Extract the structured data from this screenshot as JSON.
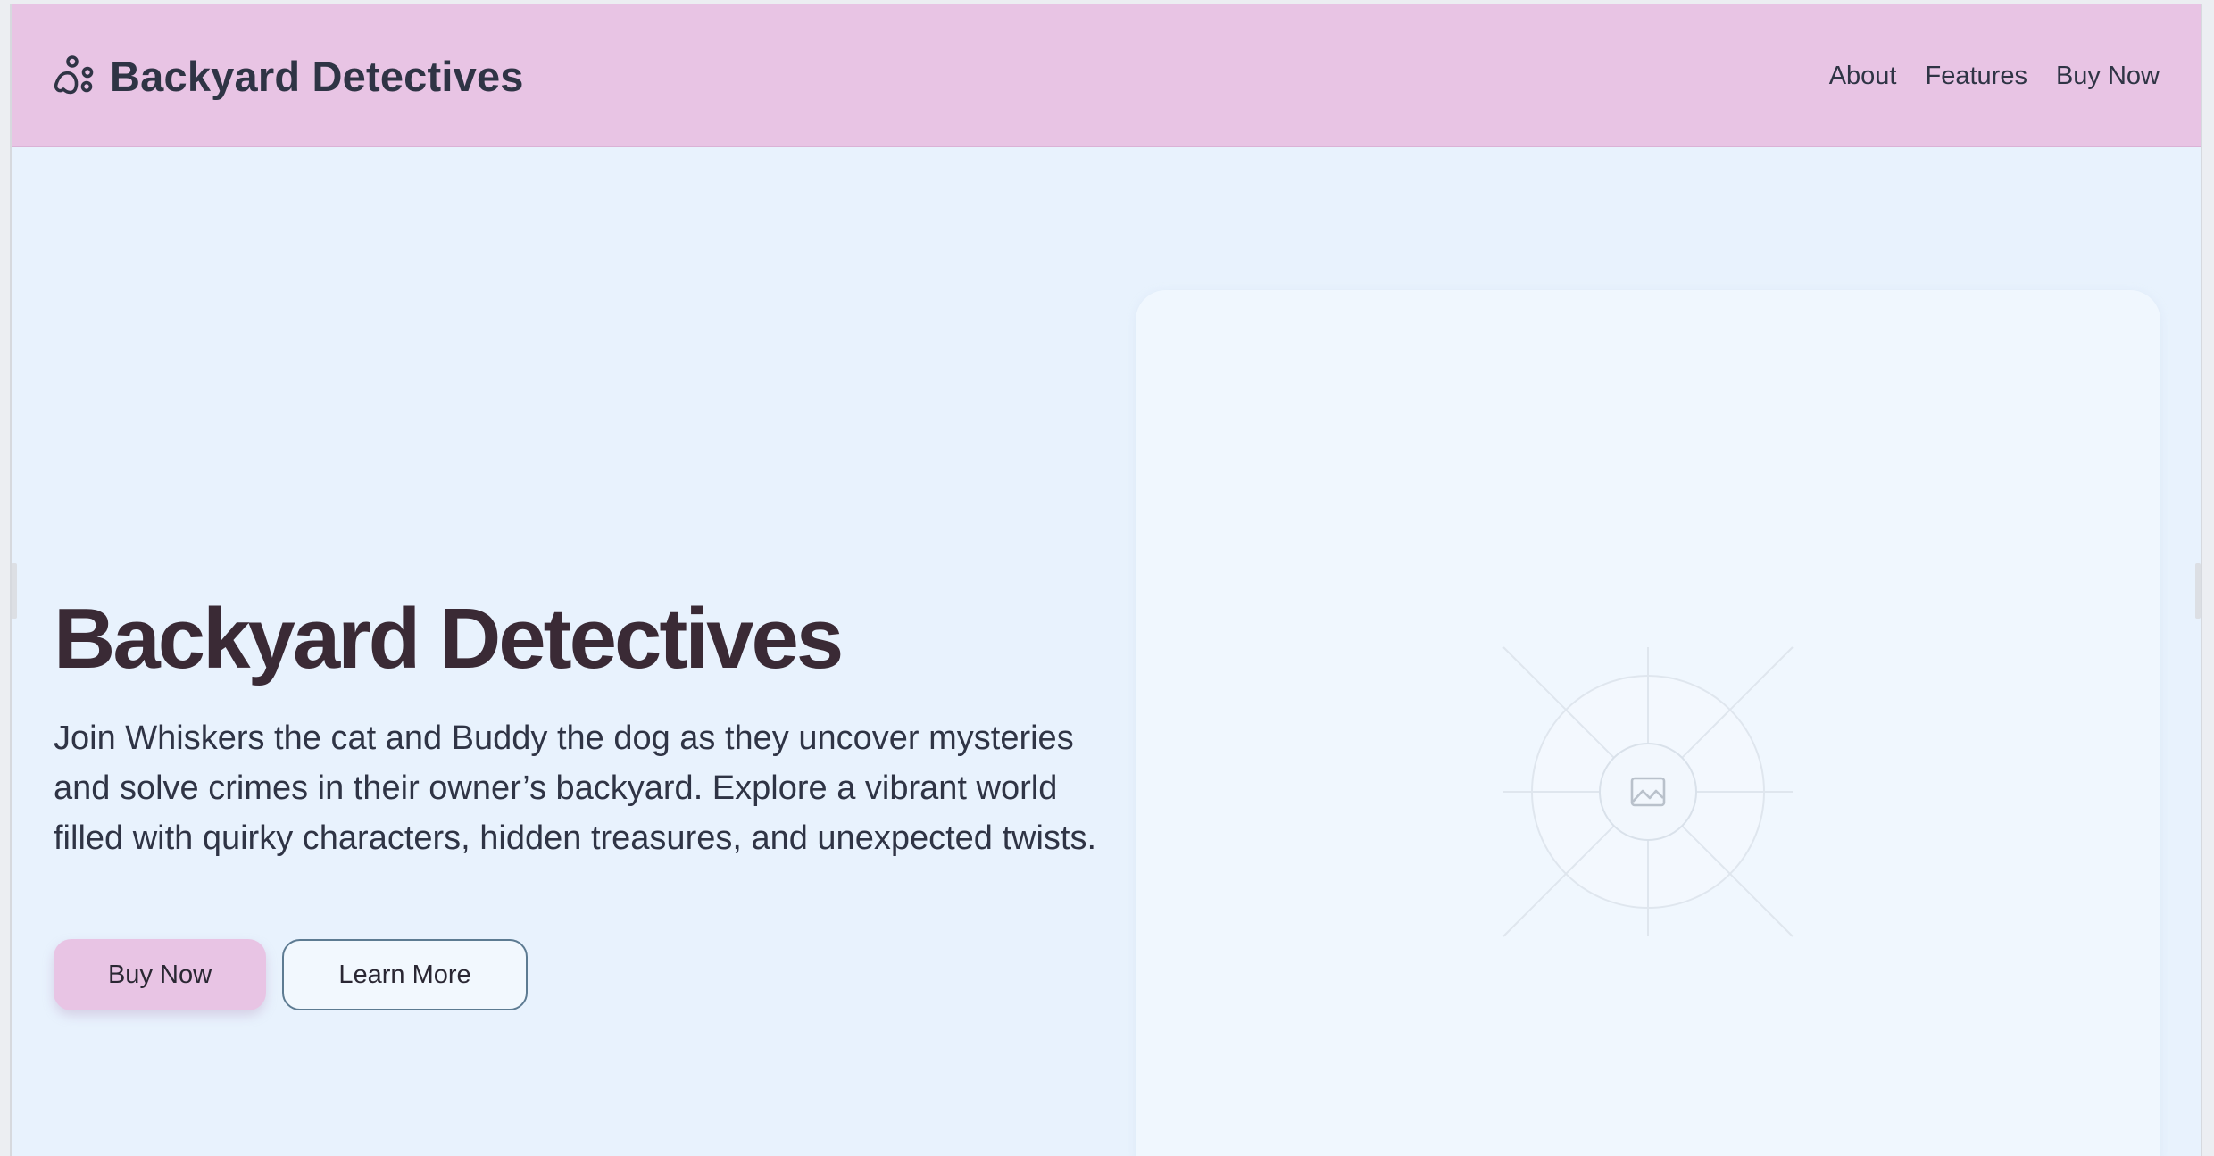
{
  "brand": {
    "name": "Backyard Detectives",
    "icon": "paw-icon"
  },
  "nav": {
    "links": [
      "About",
      "Features",
      "Buy Now"
    ]
  },
  "hero": {
    "title": "Backyard Detectives",
    "description": "Join Whiskers the cat and Buddy the dog as they uncover mysteries and solve crimes in their owner’s backyard. Explore a vibrant world filled with quirky characters, hidden treasures, and unexpected twists.",
    "primary_button": "Buy Now",
    "secondary_button": "Learn More",
    "image_icon": "image-placeholder-icon"
  },
  "colors": {
    "header_bg": "#e8c4e4",
    "page_bg": "#e8f2fd",
    "title_text": "#3a2a35",
    "body_text": "#2f3445",
    "secondary_button_border": "#5d7b92"
  }
}
